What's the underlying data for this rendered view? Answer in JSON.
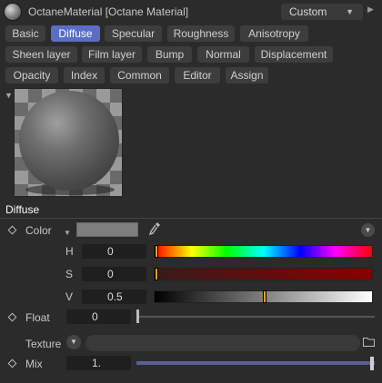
{
  "header": {
    "title": "OctaneMaterial [Octane Material]",
    "preset_value": "Custom"
  },
  "tabs": [
    {
      "label": "Basic",
      "active": false
    },
    {
      "label": "Diffuse",
      "active": true
    },
    {
      "label": "Specular",
      "active": false
    },
    {
      "label": "Roughness",
      "active": false
    },
    {
      "label": "Anisotropy",
      "active": false
    },
    {
      "label": "Sheen layer",
      "active": false
    },
    {
      "label": "Film layer",
      "active": false
    },
    {
      "label": "Bump",
      "active": false
    },
    {
      "label": "Normal",
      "active": false
    },
    {
      "label": "Displacement",
      "active": false
    },
    {
      "label": "Opacity",
      "active": false
    },
    {
      "label": "Index",
      "active": false
    },
    {
      "label": "Common",
      "active": false
    },
    {
      "label": "Editor",
      "active": false
    },
    {
      "label": "Assign",
      "active": false
    }
  ],
  "section": {
    "title": "Diffuse"
  },
  "color": {
    "label": "Color",
    "swatch_color": "#7e7e7e",
    "h_label": "H",
    "h_value": "0",
    "h_fraction": 0.0,
    "s_label": "S",
    "s_value": "0",
    "s_fraction": 0.0,
    "v_label": "V",
    "v_value": "0.5",
    "v_fraction": 0.5
  },
  "float": {
    "label": "Float",
    "value": "0",
    "fraction": 0.0
  },
  "texture": {
    "label": "Texture",
    "value": ""
  },
  "mix": {
    "label": "Mix",
    "value": "1.",
    "fraction": 1.0
  },
  "colors": {
    "accent": "#5a6ec4",
    "marker": "#f0a020",
    "mix_bar": "#5a6096"
  },
  "icons": [
    "material-icon",
    "dropdown-arrow-icon",
    "collapse-icon",
    "eyedropper-icon",
    "folder-icon",
    "keyframe-diamond-icon"
  ]
}
